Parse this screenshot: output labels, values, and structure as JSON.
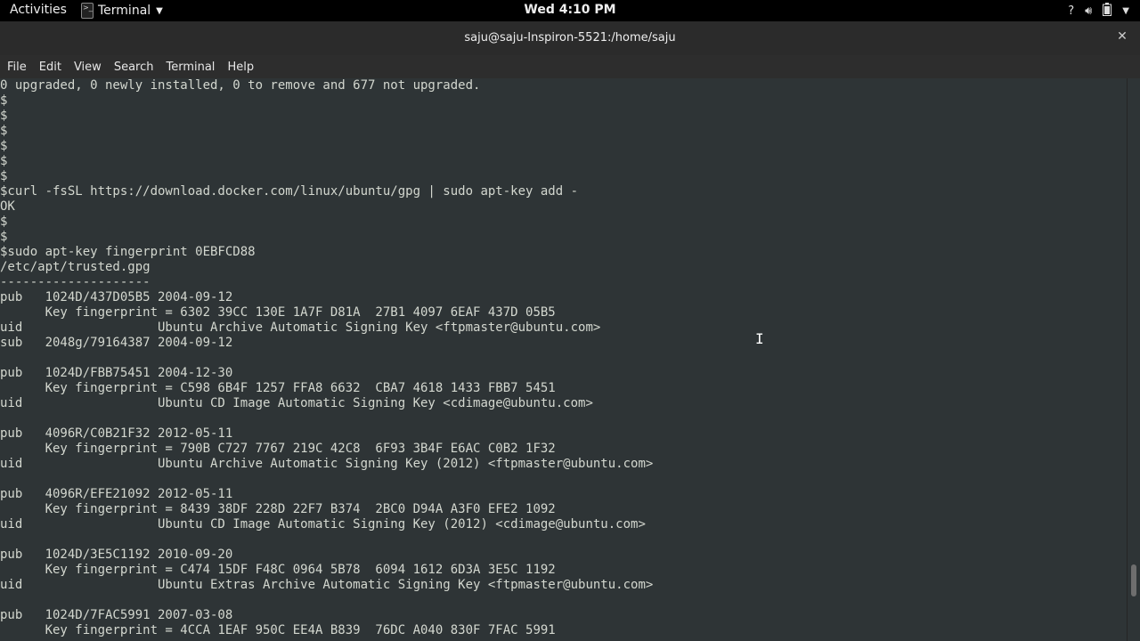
{
  "topbar": {
    "activities": "Activities",
    "app_menu": "Terminal",
    "clock": "Wed  4:10 PM",
    "icons": [
      "help-icon",
      "volume-icon",
      "battery-icon",
      "dropdown-icon"
    ]
  },
  "window": {
    "title": "saju@saju-Inspiron-5521:/home/saju",
    "close_glyph": "✕"
  },
  "menubar": {
    "items": [
      "File",
      "Edit",
      "View",
      "Search",
      "Terminal",
      "Help"
    ]
  },
  "terminal": {
    "lines": [
      "0 upgraded, 0 newly installed, 0 to remove and 677 not upgraded.",
      "$",
      "$",
      "$",
      "$",
      "$",
      "$",
      "$curl -fsSL https://download.docker.com/linux/ubuntu/gpg | sudo apt-key add -",
      "OK",
      "$",
      "$",
      "$sudo apt-key fingerprint 0EBFCD88",
      "/etc/apt/trusted.gpg",
      "--------------------",
      "pub   1024D/437D05B5 2004-09-12",
      "      Key fingerprint = 6302 39CC 130E 1A7F D81A  27B1 4097 6EAF 437D 05B5",
      "uid                  Ubuntu Archive Automatic Signing Key <ftpmaster@ubuntu.com>",
      "sub   2048g/79164387 2004-09-12",
      "",
      "pub   1024D/FBB75451 2004-12-30",
      "      Key fingerprint = C598 6B4F 1257 FFA8 6632  CBA7 4618 1433 FBB7 5451",
      "uid                  Ubuntu CD Image Automatic Signing Key <cdimage@ubuntu.com>",
      "",
      "pub   4096R/C0B21F32 2012-05-11",
      "      Key fingerprint = 790B C727 7767 219C 42C8  6F93 3B4F E6AC C0B2 1F32",
      "uid                  Ubuntu Archive Automatic Signing Key (2012) <ftpmaster@ubuntu.com>",
      "",
      "pub   4096R/EFE21092 2012-05-11",
      "      Key fingerprint = 8439 38DF 228D 22F7 B374  2BC0 D94A A3F0 EFE2 1092",
      "uid                  Ubuntu CD Image Automatic Signing Key (2012) <cdimage@ubuntu.com>",
      "",
      "pub   1024D/3E5C1192 2010-09-20",
      "      Key fingerprint = C474 15DF F48C 0964 5B78  6094 1612 6D3A 3E5C 1192",
      "uid                  Ubuntu Extras Archive Automatic Signing Key <ftpmaster@ubuntu.com>",
      "",
      "pub   1024D/7FAC5991 2007-03-08",
      "      Key fingerprint = 4CCA 1EAF 950C EE4A B839  76DC A040 830F 7FAC 5991"
    ]
  },
  "colors": {
    "terminal_bg": "#2e3436",
    "terminal_fg": "#d3d7cf",
    "topbar_bg": "#000000"
  }
}
